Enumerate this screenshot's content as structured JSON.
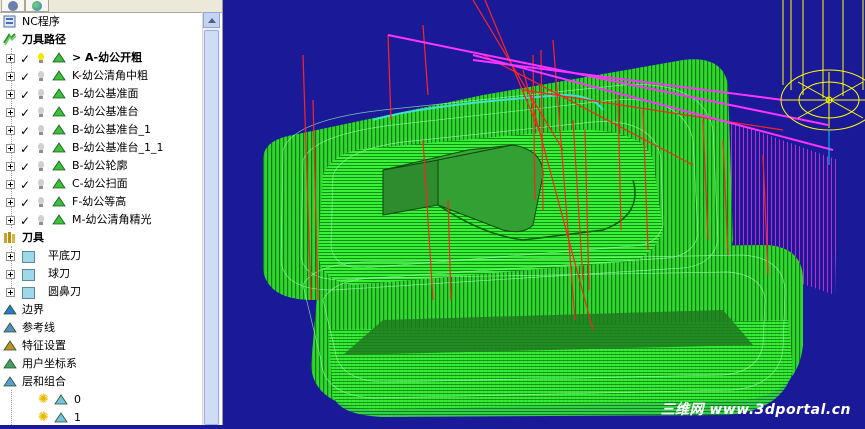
{
  "tree": {
    "root": {
      "label": "NC程序",
      "icon": "nc-program-icon"
    },
    "toolpaths": {
      "label": "刀具路径",
      "icon": "toolpath-folder-icon",
      "items": [
        {
          "label": "> A-幼公开粗",
          "active": true,
          "checked": true,
          "light_on": true,
          "icon": "rough-toolpath-icon"
        },
        {
          "label": "K-幼公清角中粗",
          "active": false,
          "checked": true,
          "light_on": false,
          "icon": "corner-rest-icon"
        },
        {
          "label": "B-幼公基准面",
          "active": false,
          "checked": true,
          "light_on": false,
          "icon": "face-toolpath-icon"
        },
        {
          "label": "B-幼公基准台",
          "active": false,
          "checked": true,
          "light_on": false,
          "icon": "platform-toolpath-icon"
        },
        {
          "label": "B-幼公基准台_1",
          "active": false,
          "checked": true,
          "light_on": false,
          "icon": "platform-toolpath-icon"
        },
        {
          "label": "B-幼公基准台_1_1",
          "active": false,
          "checked": true,
          "light_on": false,
          "icon": "platform-toolpath-icon"
        },
        {
          "label": "B-幼公轮廓",
          "active": false,
          "checked": true,
          "light_on": false,
          "icon": "profile-toolpath-icon"
        },
        {
          "label": "C-幼公扫面",
          "active": false,
          "checked": true,
          "light_on": false,
          "icon": "raster-toolpath-icon"
        },
        {
          "label": "F-幼公等高",
          "active": false,
          "checked": true,
          "light_on": false,
          "icon": "constant-z-icon"
        },
        {
          "label": "M-幼公清角精光",
          "active": false,
          "checked": true,
          "light_on": false,
          "icon": "corner-finish-icon"
        }
      ]
    },
    "tools": {
      "label": "刀具",
      "icon": "tools-folder-icon",
      "items": [
        {
          "label": "平底刀",
          "icon": "flat-endmill-icon"
        },
        {
          "label": "球刀",
          "icon": "ball-endmill-icon"
        },
        {
          "label": "圆鼻刀",
          "icon": "bullnose-endmill-icon"
        }
      ]
    },
    "others": [
      {
        "label": "边界",
        "icon": "boundary-icon"
      },
      {
        "label": "参考线",
        "icon": "pattern-icon"
      },
      {
        "label": "特征设置",
        "icon": "feature-set-icon"
      },
      {
        "label": "用户坐标系",
        "icon": "workplane-icon"
      },
      {
        "label": "层和组合",
        "icon": "levels-icon"
      }
    ],
    "levels": [
      {
        "label": "0",
        "icon": "level-icon"
      },
      {
        "label": "1",
        "icon": "level-icon"
      }
    ]
  },
  "viewport": {
    "background": "#1a1a99",
    "toolpath_color": "#33ff33",
    "rapid_color": "#ff2222",
    "lead_color": "#ff33ff",
    "tool_color": "#ffff00",
    "model_color": "#2e8b2e"
  },
  "watermark": "三维网 www.3dportal.cn"
}
